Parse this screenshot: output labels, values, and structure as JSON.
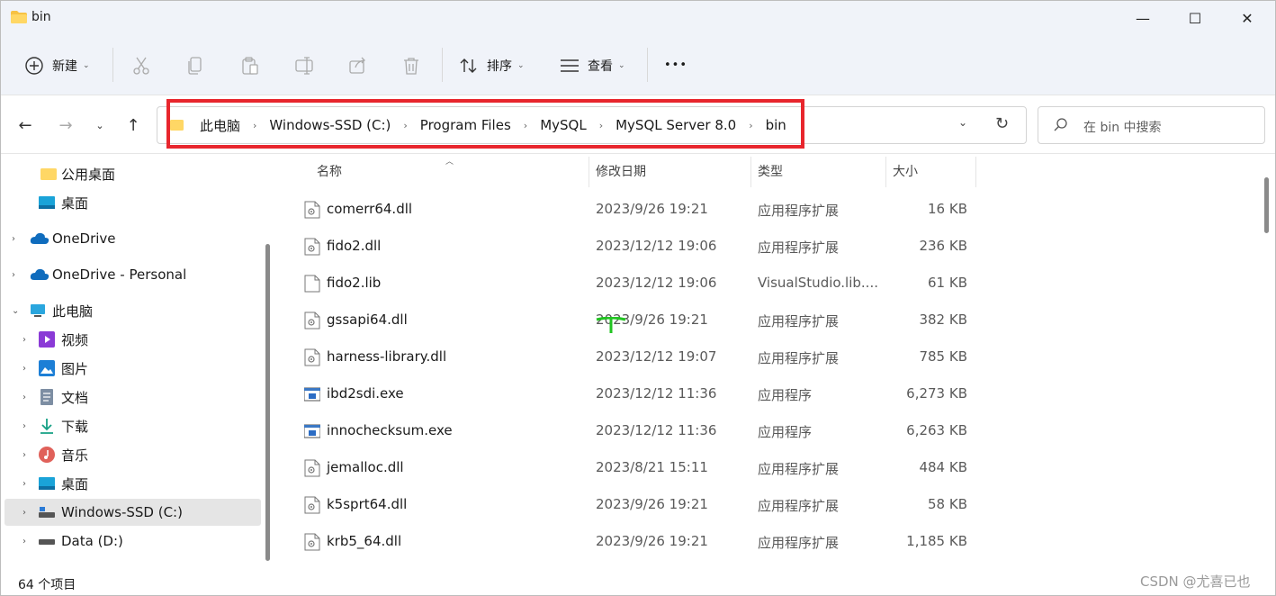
{
  "window": {
    "title": "bin",
    "minimize": "—",
    "maximize": "☐",
    "close": "✕"
  },
  "toolbar": {
    "new_label": "新建",
    "sort_label": "排序",
    "view_label": "查看",
    "more_label": "•••"
  },
  "address": {
    "crumbs": [
      "此电脑",
      "Windows-SSD (C:)",
      "Program Files",
      "MySQL",
      "MySQL Server 8.0",
      "bin"
    ],
    "search_placeholder": "在 bin 中搜索",
    "highlight_color": "#e8262d"
  },
  "sidebar": {
    "items": [
      {
        "label": "公用桌面",
        "icon": "folder-icon"
      },
      {
        "label": "桌面",
        "icon": "desktop-icon"
      },
      {
        "label": "OneDrive",
        "icon": "cloud-icon"
      },
      {
        "label": "OneDrive - Personal",
        "icon": "cloud-icon"
      },
      {
        "label": "此电脑",
        "icon": "computer-icon"
      },
      {
        "label": "视频",
        "icon": "video-icon"
      },
      {
        "label": "图片",
        "icon": "pictures-icon"
      },
      {
        "label": "文档",
        "icon": "documents-icon"
      },
      {
        "label": "下载",
        "icon": "download-icon"
      },
      {
        "label": "音乐",
        "icon": "music-icon"
      },
      {
        "label": "桌面",
        "icon": "desktop-icon"
      },
      {
        "label": "Windows-SSD (C:)",
        "icon": "drive-icon"
      },
      {
        "label": "Data (D:)",
        "icon": "drive-icon"
      }
    ],
    "selected": "Windows-SSD (C:)"
  },
  "columns": {
    "name": "名称",
    "date": "修改日期",
    "type": "类型",
    "size": "大小"
  },
  "files": [
    {
      "name": "comerr64.dll",
      "date": "2023/9/26 19:21",
      "type": "应用程序扩展",
      "size": "16 KB",
      "kind": "dll"
    },
    {
      "name": "fido2.dll",
      "date": "2023/12/12 19:06",
      "type": "应用程序扩展",
      "size": "236 KB",
      "kind": "dll"
    },
    {
      "name": "fido2.lib",
      "date": "2023/12/12 19:06",
      "type": "VisualStudio.lib....",
      "size": "61 KB",
      "kind": "lib"
    },
    {
      "name": "gssapi64.dll",
      "date": "2023/9/26 19:21",
      "type": "应用程序扩展",
      "size": "382 KB",
      "kind": "dll"
    },
    {
      "name": "harness-library.dll",
      "date": "2023/12/12 19:07",
      "type": "应用程序扩展",
      "size": "785 KB",
      "kind": "dll"
    },
    {
      "name": "ibd2sdi.exe",
      "date": "2023/12/12 11:36",
      "type": "应用程序",
      "size": "6,273 KB",
      "kind": "exe"
    },
    {
      "name": "innochecksum.exe",
      "date": "2023/12/12 11:36",
      "type": "应用程序",
      "size": "6,263 KB",
      "kind": "exe"
    },
    {
      "name": "jemalloc.dll",
      "date": "2023/8/21 15:11",
      "type": "应用程序扩展",
      "size": "484 KB",
      "kind": "dll"
    },
    {
      "name": "k5sprt64.dll",
      "date": "2023/9/26 19:21",
      "type": "应用程序扩展",
      "size": "58 KB",
      "kind": "dll"
    },
    {
      "name": "krb5_64.dll",
      "date": "2023/9/26 19:21",
      "type": "应用程序扩展",
      "size": "1,185 KB",
      "kind": "dll"
    }
  ],
  "status": {
    "item_count": "64 个项目"
  },
  "watermark": "CSDN @尤喜已也"
}
